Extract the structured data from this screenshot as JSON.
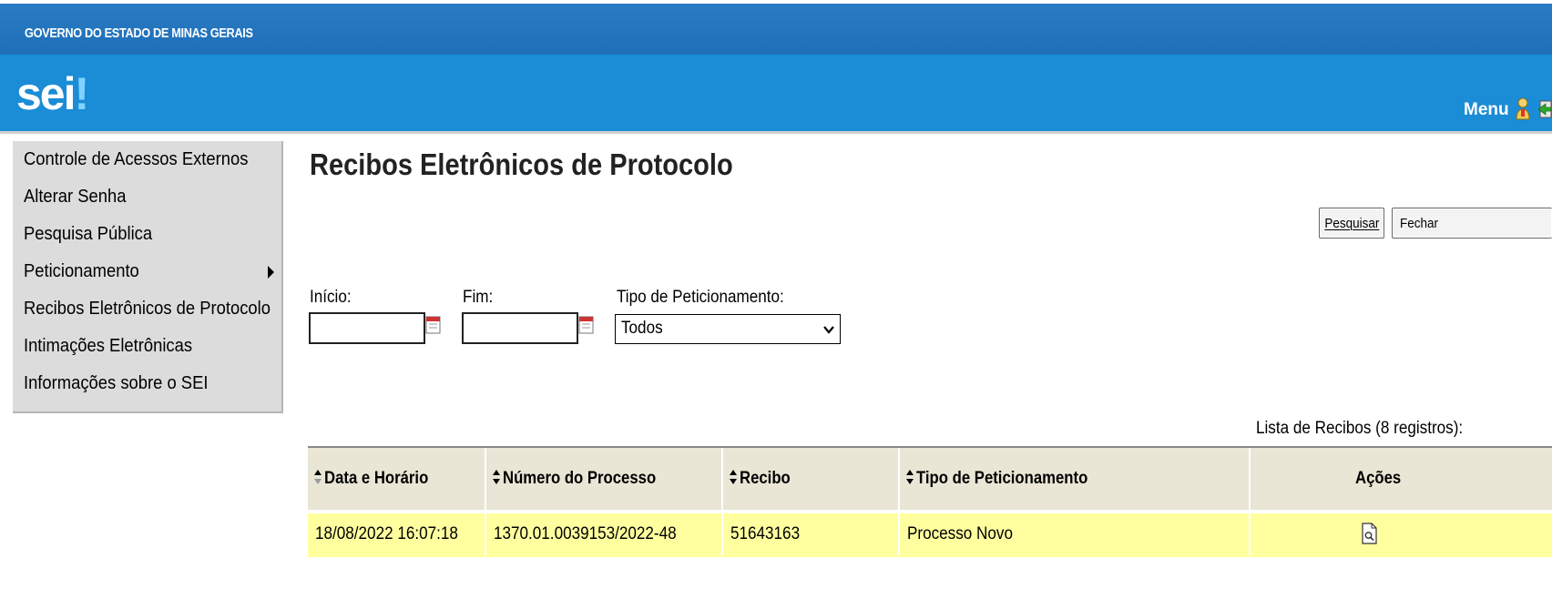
{
  "header": {
    "gov_title": "GOVERNO DO ESTADO DE MINAS GERAIS",
    "logo_text": "sei",
    "logo_bang": "!",
    "menu_label": "Menu"
  },
  "sidebar": {
    "items": [
      {
        "label": "Controle de Acessos Externos"
      },
      {
        "label": "Alterar Senha"
      },
      {
        "label": "Pesquisa Pública"
      },
      {
        "label": "Peticionamento",
        "has_submenu": true
      },
      {
        "label": "Recibos Eletrônicos de Protocolo"
      },
      {
        "label": "Intimações Eletrônicas"
      },
      {
        "label": "Informações sobre o SEI"
      }
    ]
  },
  "main": {
    "title": "Recibos Eletrônicos de Protocolo",
    "buttons": {
      "pesquisar_label": "Pesquisar",
      "fechar_label": "Fechar"
    },
    "filters": {
      "inicio_label": "Início:",
      "inicio_value": "",
      "fim_label": "Fim:",
      "fim_value": "",
      "tipo_label": "Tipo de Peticionamento:",
      "tipo_value": "Todos"
    },
    "table": {
      "caption": "Lista de Recibos (8 registros):",
      "columns": [
        "Data e Horário",
        "Número do Processo",
        "Recibo",
        "Tipo de Peticionamento",
        "Ações"
      ],
      "rows": [
        {
          "data_horario": "18/08/2022 16:07:18",
          "numero_processo": "1370.01.0039153/2022-48",
          "recibo": "51643163",
          "tipo": "Processo Novo",
          "acoes_icon": "document-view-icon"
        }
      ]
    }
  },
  "colors": {
    "topbar": "#2a7cc4",
    "brandbar": "#1b8cd6",
    "sidebar_bg": "#dcdcdc",
    "table_header_bg": "#e9e6d6",
    "row_highlight": "#ffff9f"
  }
}
